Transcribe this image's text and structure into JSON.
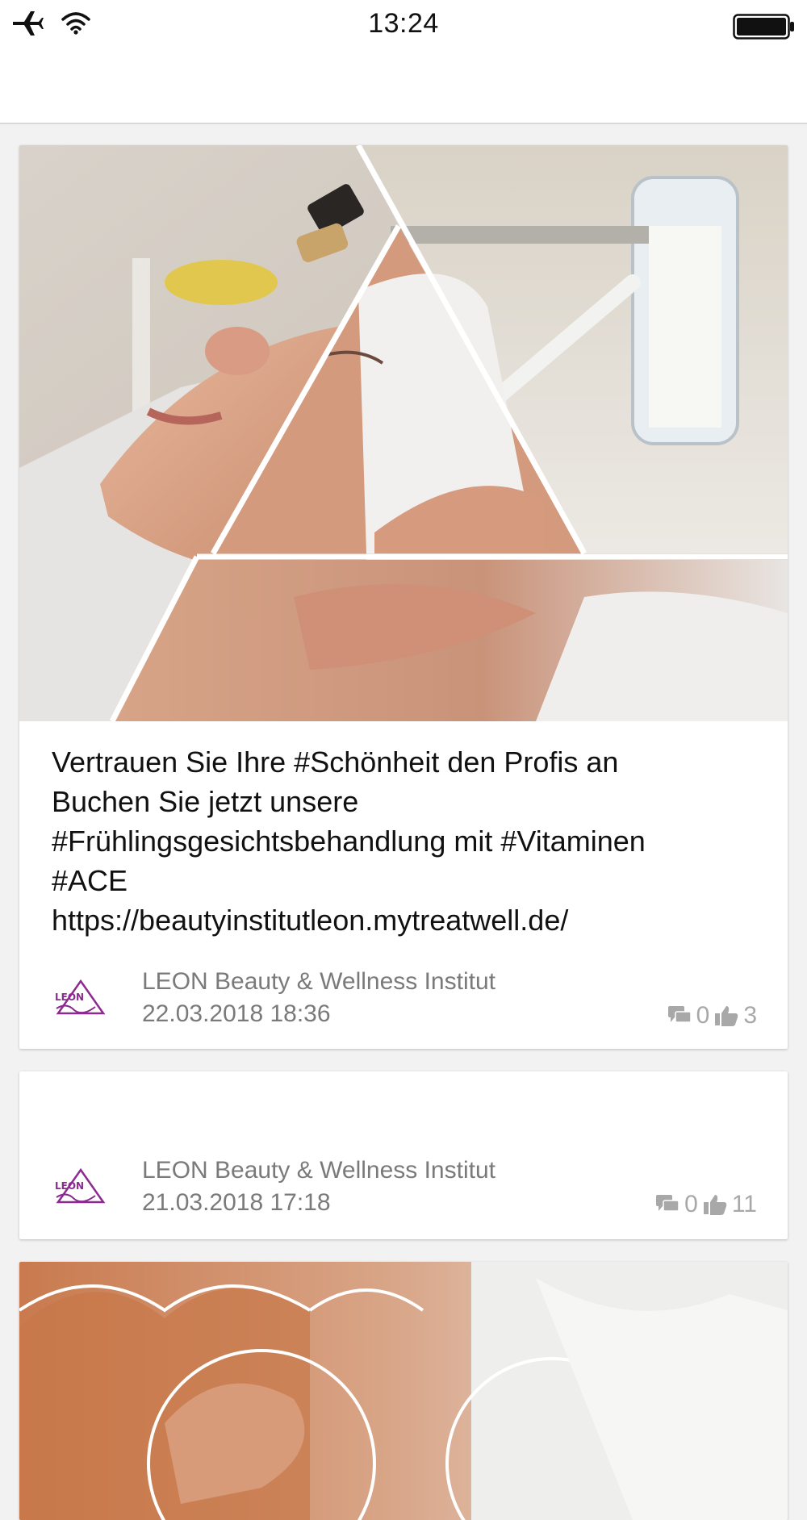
{
  "status_bar": {
    "time": "13:24",
    "icons": [
      "airplane-icon",
      "wifi-icon",
      "battery-icon"
    ]
  },
  "posts": [
    {
      "text": "Vertrauen Sie Ihre #Schönheit den Profis an\nBuchen Sie jetzt unsere\n#Frühlingsgesichtsbehandlung mit #Vitaminen\n#ACE\nhttps://beautyinstitutleon.mytreatwell.de/",
      "author": "LEON Beauty & Wellness Institut",
      "date": "22.03.2018 18:36",
      "comments": "0",
      "likes": "3"
    },
    {
      "text": "",
      "author": "LEON Beauty & Wellness Institut",
      "date": "21.03.2018 17:18",
      "comments": "0",
      "likes": "11"
    }
  ],
  "colors": {
    "meta_text": "#7a7a7a",
    "stats_text": "#a8a8a8",
    "logo_purple": "#8b2a8f"
  }
}
